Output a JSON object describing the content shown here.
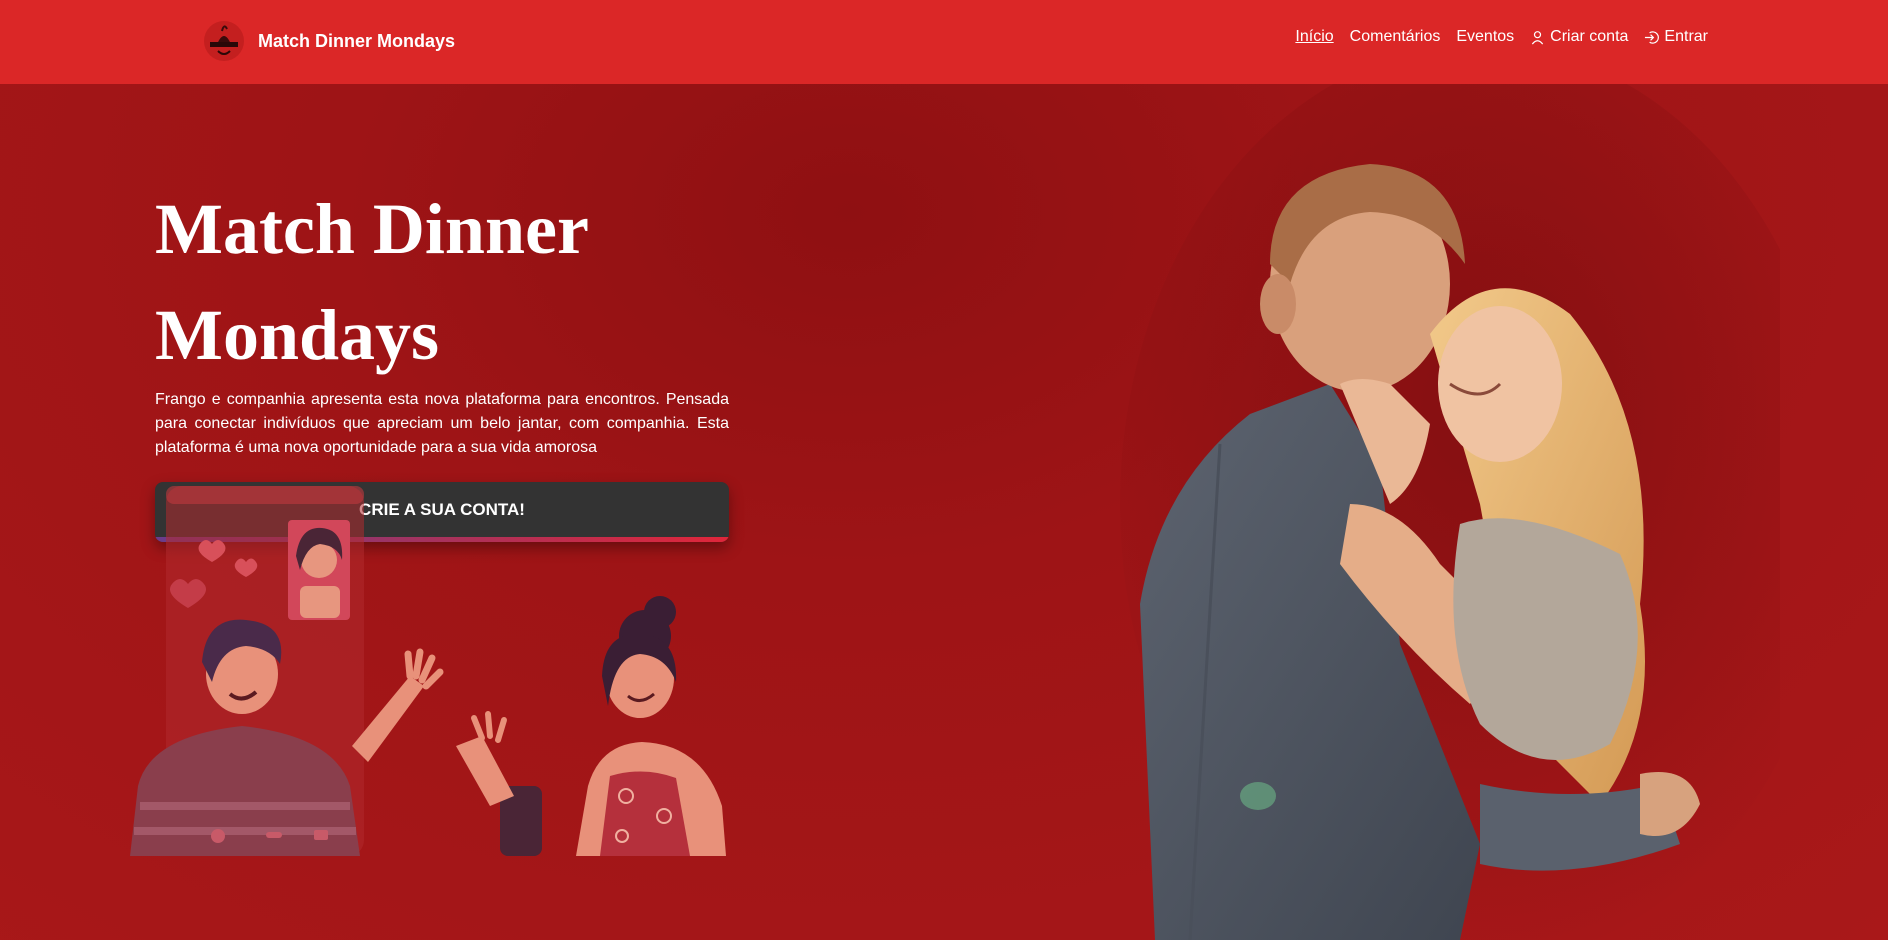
{
  "navbar": {
    "brand_name": "Match Dinner Mondays",
    "logo_icon": "brand-logo-icon",
    "links": [
      {
        "label": "Início",
        "active": true
      },
      {
        "label": "Comentários",
        "active": false
      },
      {
        "label": "Eventos",
        "active": false
      },
      {
        "label": "Criar conta",
        "icon": "user-icon",
        "active": false
      },
      {
        "label": "Entrar",
        "icon": "login-icon",
        "active": false
      }
    ]
  },
  "hero": {
    "title": "Match Dinner Mondays",
    "description": "Frango e companhia apresenta esta nova plataforma para encontros. Pensada para conectar indivíduos que apreciam um belo jantar, com companhia. Esta plataforma é uma nova oportunidade para a sua vida amorosa",
    "cta_label": "CRIE A SUA CONTA!"
  },
  "colors": {
    "navbar_bg": "#db2727",
    "hero_bg": "#a01416",
    "button_bg": "#333333",
    "text": "#ffffff"
  }
}
